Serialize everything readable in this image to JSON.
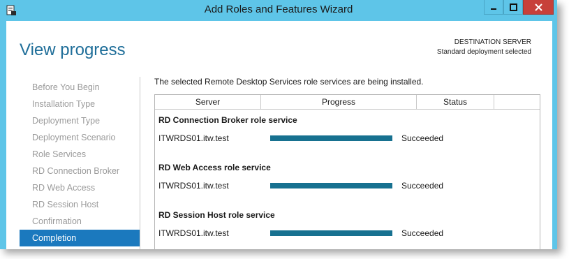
{
  "window": {
    "title": "Add Roles and Features Wizard",
    "accent": "#5ec5e8",
    "close_color": "#c7403a"
  },
  "page": {
    "title": "View progress",
    "destination_label": "DESTINATION SERVER",
    "destination_value": "Standard deployment selected"
  },
  "nav": {
    "items": [
      {
        "label": "Before You Begin",
        "active": false
      },
      {
        "label": "Installation Type",
        "active": false
      },
      {
        "label": "Deployment Type",
        "active": false
      },
      {
        "label": "Deployment Scenario",
        "active": false
      },
      {
        "label": "Role Services",
        "active": false
      },
      {
        "label": "RD Connection Broker",
        "active": false
      },
      {
        "label": "RD Web Access",
        "active": false
      },
      {
        "label": "RD Session Host",
        "active": false
      },
      {
        "label": "Confirmation",
        "active": false
      },
      {
        "label": "Completion",
        "active": true
      }
    ]
  },
  "main": {
    "intro": "The selected Remote Desktop Services role services are being installed.",
    "columns": {
      "server": "Server",
      "progress": "Progress",
      "status": "Status"
    },
    "groups": [
      {
        "title": "RD Connection Broker role service",
        "server": "ITWRDS01.itw.test",
        "progress": 1.0,
        "status": "Succeeded"
      },
      {
        "title": "RD Web Access role service",
        "server": "ITWRDS01.itw.test",
        "progress": 1.0,
        "status": "Succeeded"
      },
      {
        "title": "RD Session Host role service",
        "server": "ITWRDS01.itw.test",
        "progress": 1.0,
        "status": "Succeeded"
      }
    ]
  }
}
